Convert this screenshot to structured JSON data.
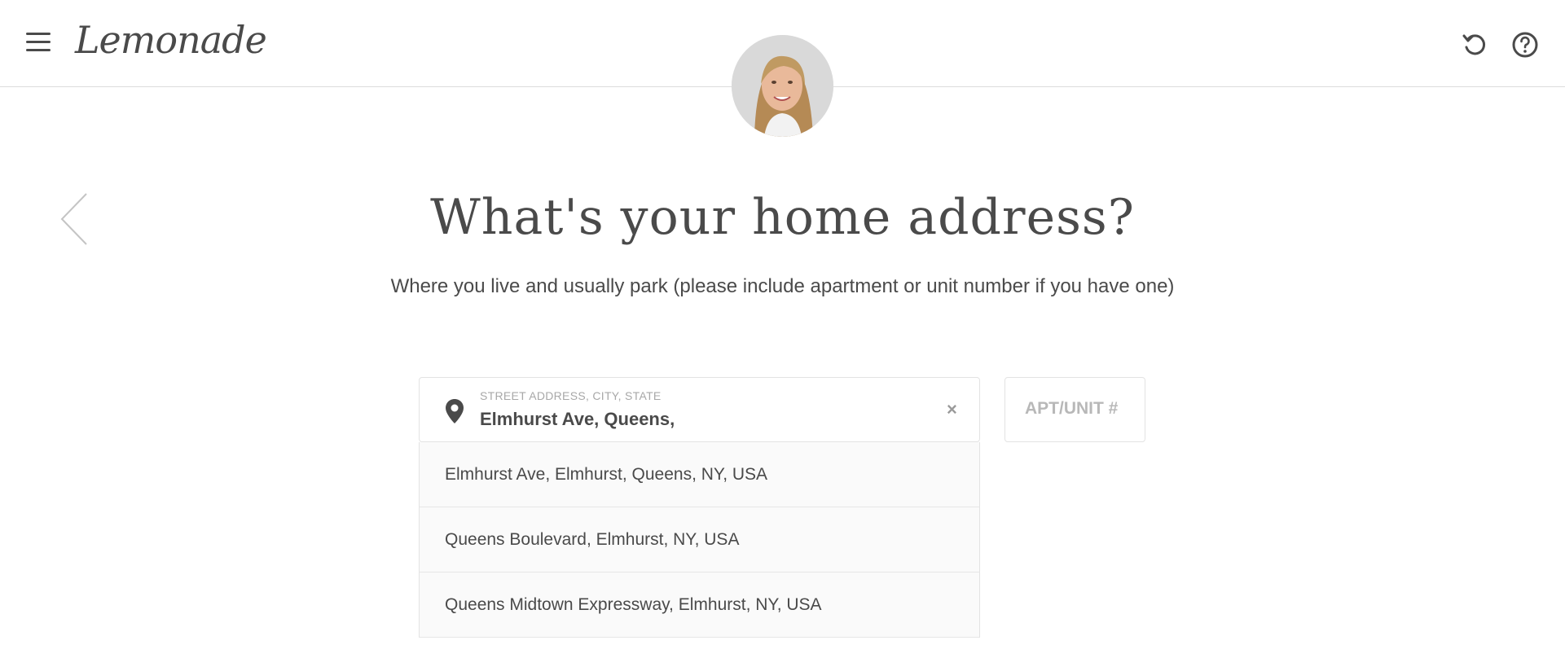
{
  "header": {
    "logo_text": "Lemonade",
    "menu_icon": "hamburger-menu-icon",
    "undo_icon": "undo-icon",
    "help_icon": "help-icon"
  },
  "page": {
    "title": "What's your home address?",
    "subtitle": "Where you live and usually park (please include apartment or unit number if you have one)"
  },
  "address_field": {
    "label": "STREET ADDRESS, CITY, STATE",
    "value": "Elmhurst Ave, Queens,",
    "clear_symbol": "×"
  },
  "apt_field": {
    "placeholder": "APT/UNIT #"
  },
  "suggestions": [
    {
      "label": "Elmhurst Ave, Elmhurst, Queens, NY, USA"
    },
    {
      "label": "Queens Boulevard, Elmhurst, NY, USA"
    },
    {
      "label": "Queens Midtown Expressway, Elmhurst, NY, USA"
    }
  ],
  "colors": {
    "text": "#4a4a4a",
    "muted": "#a8a8a8",
    "border": "#e3e3e3"
  }
}
